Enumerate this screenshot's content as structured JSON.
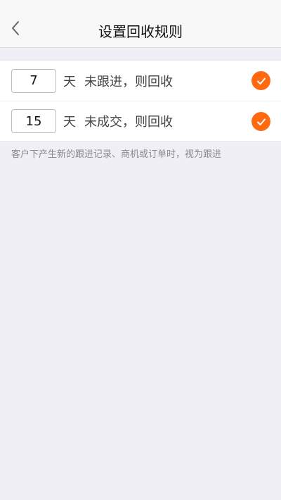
{
  "header": {
    "title": "设置回收规则",
    "back_icon": "chevron-left-icon"
  },
  "rules": [
    {
      "days": "7",
      "unit": "天",
      "description": "未跟进，则回收",
      "checked": true
    },
    {
      "days": "15",
      "unit": "天",
      "description": "未成交，则回收",
      "checked": true
    }
  ],
  "note": "客户下产生新的跟进记录、商机或订单时，视为跟进",
  "colors": {
    "accent": "#ff6a10",
    "background": "#f0eff5",
    "surface": "#ffffff",
    "nav_background": "#f8f8f8",
    "muted_text": "#8a8a8a"
  }
}
